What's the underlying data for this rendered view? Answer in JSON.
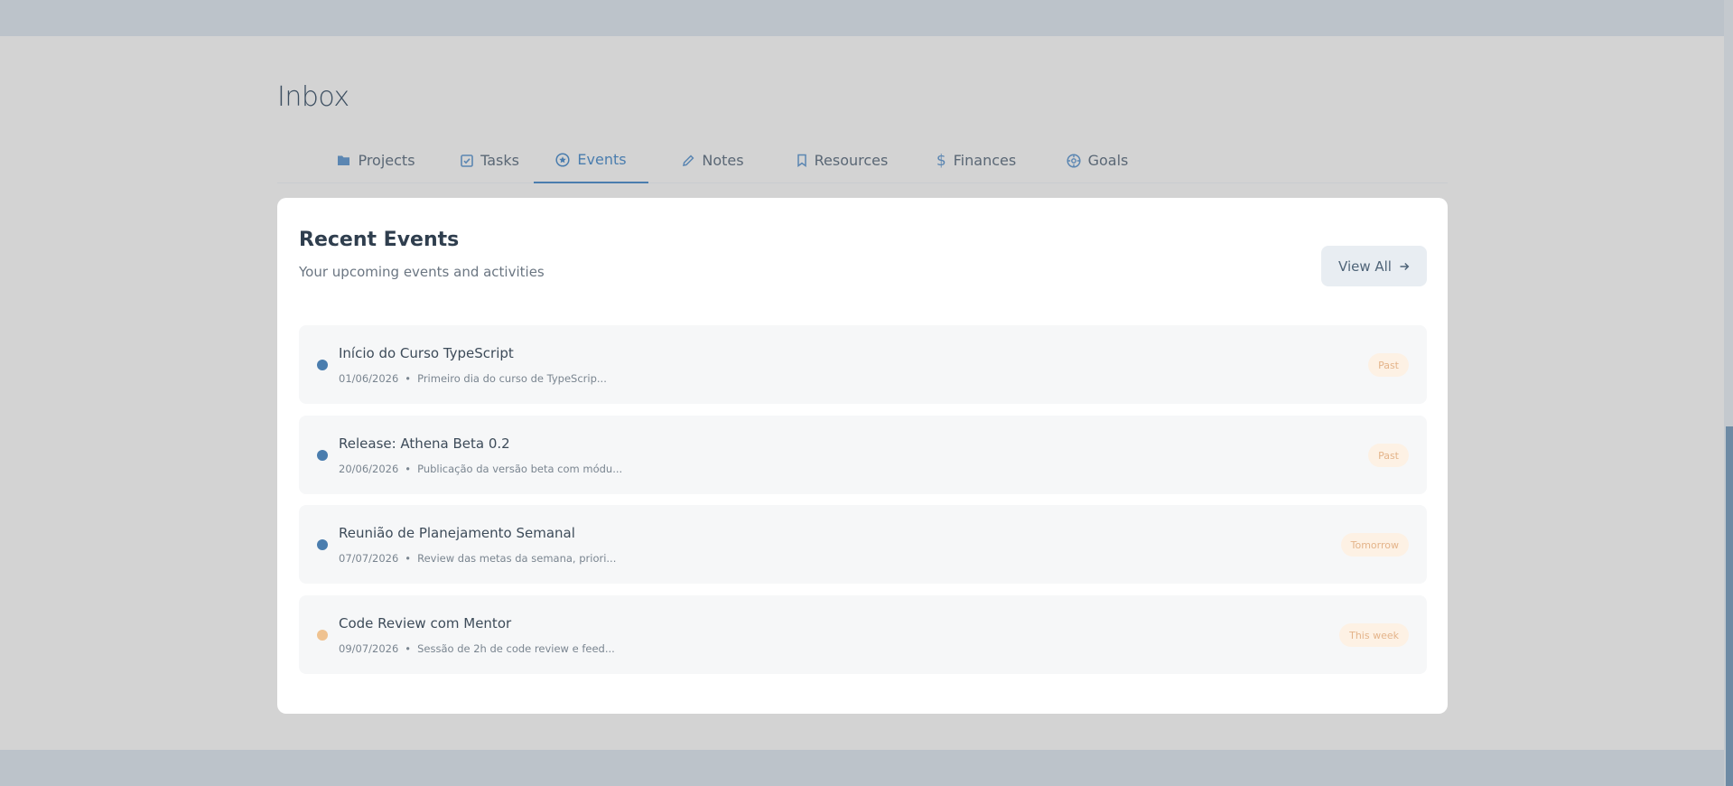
{
  "page": {
    "title": "Inbox"
  },
  "tabs": [
    {
      "label": "Projects",
      "icon": "folder-icon"
    },
    {
      "label": "Tasks",
      "icon": "checkbox-icon"
    },
    {
      "label": "Events",
      "icon": "star-circle-icon",
      "active": true
    },
    {
      "label": "Notes",
      "icon": "pencil-icon"
    },
    {
      "label": "Resources",
      "icon": "bookmark-icon"
    },
    {
      "label": "Finances",
      "icon": "dollar-icon"
    },
    {
      "label": "Goals",
      "icon": "target-icon"
    }
  ],
  "card": {
    "title": "Recent Events",
    "subtitle": "Your upcoming events and activities",
    "view_all_label": "View All"
  },
  "events": [
    {
      "title": "Início do Curso TypeScript",
      "date": "01/06/2026",
      "description": "Primeiro dia do curso de TypeScrip...",
      "badge": "Past",
      "dot_color": "#4a7dae"
    },
    {
      "title": "Release: Athena Beta 0.2",
      "date": "20/06/2026",
      "description": "Publicação da versão beta com módu...",
      "badge": "Past",
      "dot_color": "#4a7dae"
    },
    {
      "title": "Reunião de Planejamento Semanal",
      "date": "07/07/2026",
      "description": "Review das metas da semana, priori...",
      "badge": "Tomorrow",
      "dot_color": "#4a7dae"
    },
    {
      "title": "Code Review com Mentor",
      "date": "09/07/2026",
      "description": "Sessão de 2h de code review e feed...",
      "badge": "This week",
      "dot_color": "#efc290"
    }
  ],
  "colors": {
    "accent": "#4a7dae",
    "background": "#d3d3d3",
    "card": "#ffffff",
    "badge_bg": "#fdf1e4",
    "badge_text": "#e4b48a"
  }
}
